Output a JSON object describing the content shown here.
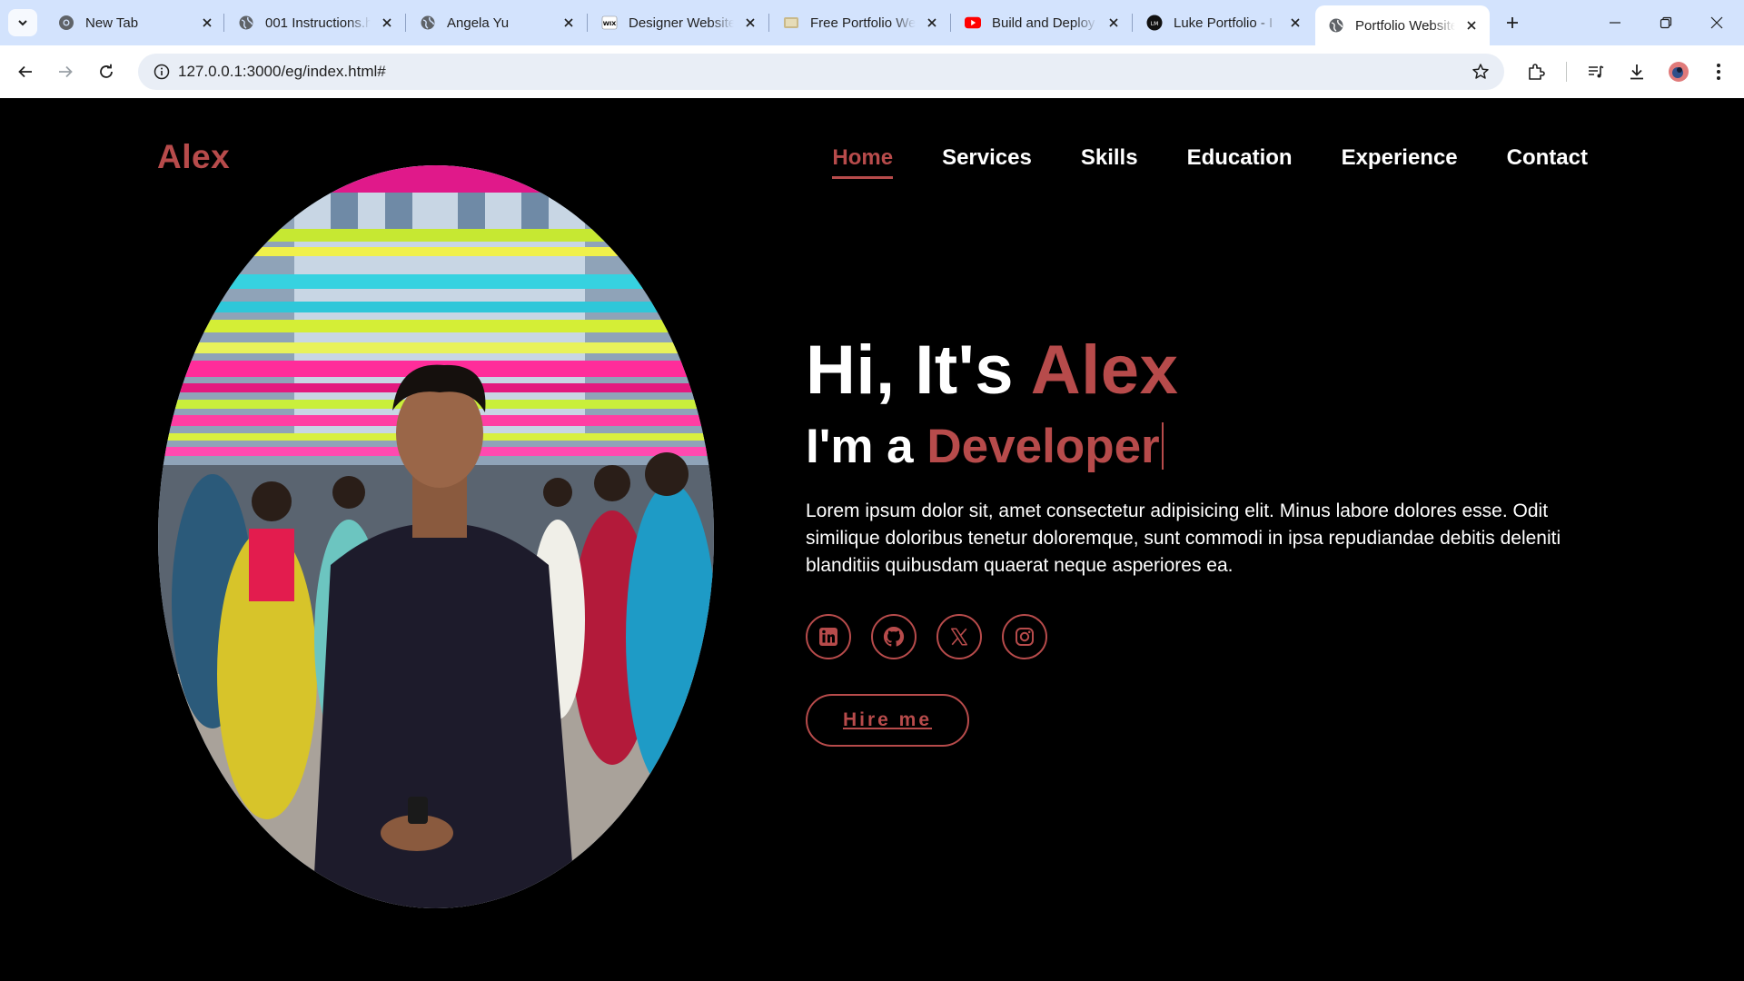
{
  "browser": {
    "tabs": [
      {
        "title": "New Tab",
        "favicon": "chrome-icon",
        "active": false
      },
      {
        "title": "001 Instructions.h",
        "favicon": "globe-icon",
        "active": false
      },
      {
        "title": "Angela Yu",
        "favicon": "globe-icon",
        "active": false
      },
      {
        "title": "Designer Website",
        "favicon": "wix-icon",
        "active": false
      },
      {
        "title": "Free Portfolio Web",
        "favicon": "image-icon",
        "active": false
      },
      {
        "title": "Build and Deploy",
        "favicon": "youtube-icon",
        "active": false
      },
      {
        "title": "Luke Portfolio - I",
        "favicon": "dark-circle-icon",
        "active": false
      },
      {
        "title": "Portfolio Website",
        "favicon": "globe-icon",
        "active": true
      }
    ],
    "url": "127.0.0.1:3000/eg/index.html#"
  },
  "site": {
    "logo": "Alex",
    "nav": [
      {
        "label": "Home",
        "active": true
      },
      {
        "label": "Services",
        "active": false
      },
      {
        "label": "Skills",
        "active": false
      },
      {
        "label": "Education",
        "active": false
      },
      {
        "label": "Experience",
        "active": false
      },
      {
        "label": "Contact",
        "active": false
      }
    ],
    "hero": {
      "greeting": "Hi, It's ",
      "name": "Alex",
      "role_prefix": "I'm a ",
      "role": "Developer",
      "description": "Lorem ipsum dolor sit, amet consectetur adipisicing elit. Minus labore dolores esse. Odit similique doloribus tenetur doloremque, sunt commodi in ipsa repudiandae debitis deleniti blanditiis quibusdam quaerat neque asperiores ea.",
      "socials": [
        "linkedin-icon",
        "github-icon",
        "x-icon",
        "instagram-icon"
      ],
      "hire_label": "Hire me"
    }
  },
  "colors": {
    "accent": "#b74b4b",
    "page_bg": "#000000",
    "tabstrip_bg": "#d3e3fd"
  }
}
